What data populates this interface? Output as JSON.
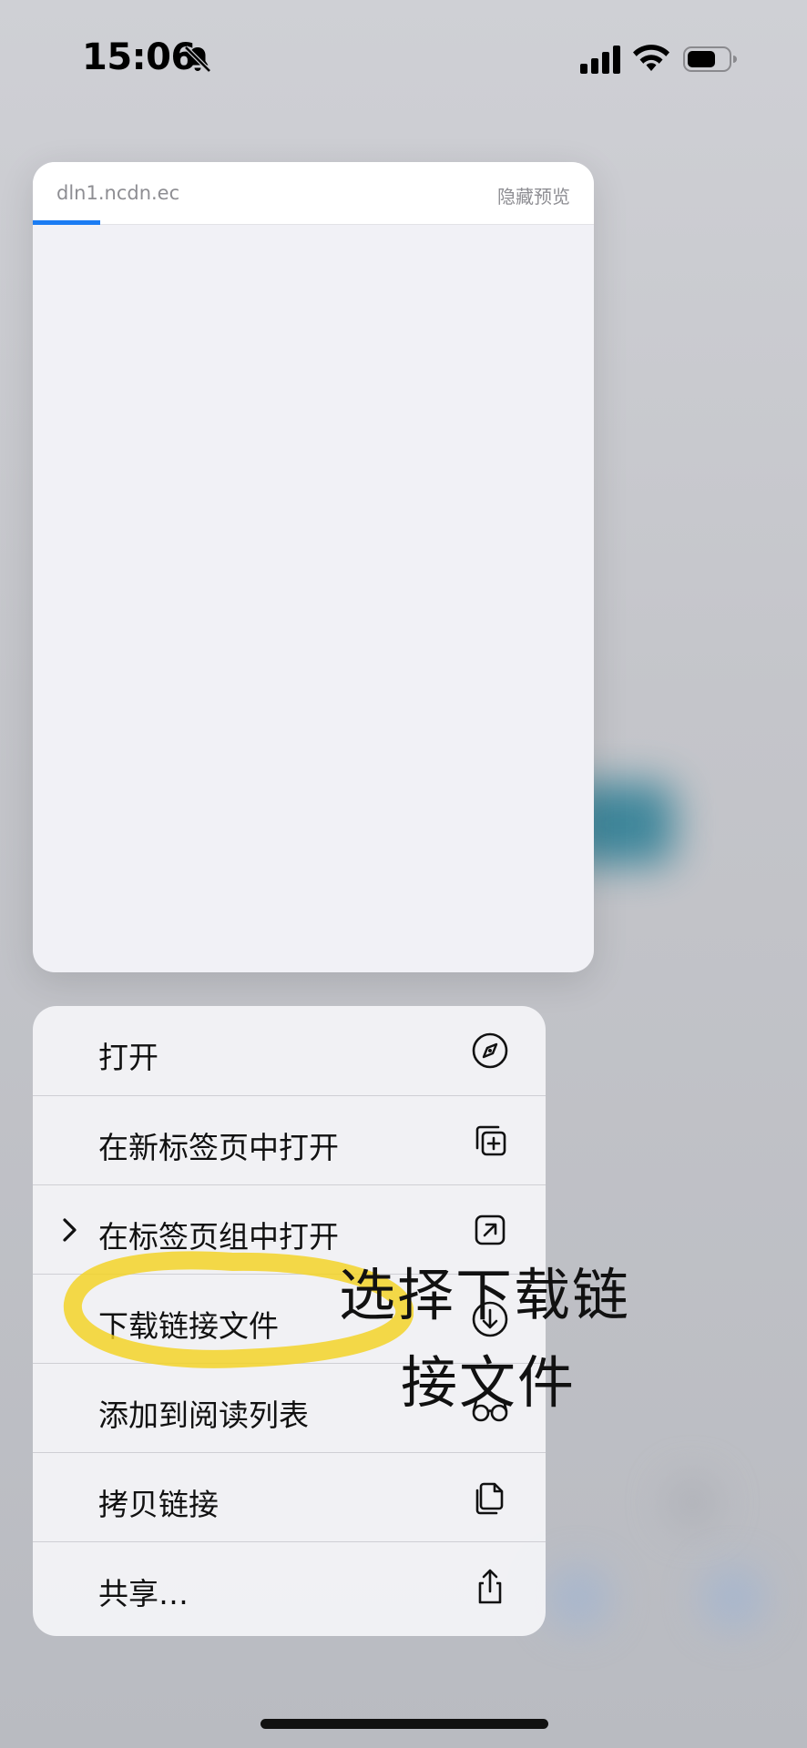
{
  "status_bar": {
    "time": "15:06",
    "icons": [
      "bell-slash-icon",
      "cellular-signal-icon",
      "wifi-icon",
      "battery-icon"
    ]
  },
  "preview": {
    "url": "dln1.ncdn.ec",
    "hide_label": "隐藏预览",
    "load_progress": 0.12,
    "accent_color": "#1b7cf3"
  },
  "menu": {
    "items": [
      {
        "label": "打开",
        "icon": "compass-icon"
      },
      {
        "label": "在新标签页中打开",
        "icon": "plus-square-on-square-icon"
      },
      {
        "label": "在标签页组中打开",
        "icon": "arrow-up-right-square-icon",
        "has_submenu": true
      },
      {
        "label": "下载链接文件",
        "icon": "arrow-down-circle-icon"
      },
      {
        "label": "添加到阅读列表",
        "icon": "eyeglasses-icon"
      },
      {
        "label": "拷贝链接",
        "icon": "doc-on-doc-icon"
      },
      {
        "label": "共享…",
        "icon": "share-icon"
      }
    ]
  },
  "annotation": {
    "line1": "选择下载链",
    "line2": "接文件",
    "highlight_color": "#f4d21c"
  }
}
